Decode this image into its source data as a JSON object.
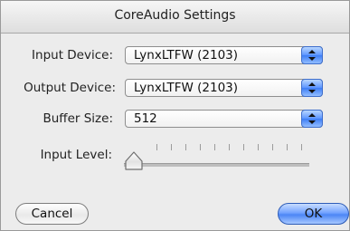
{
  "window": {
    "title": "CoreAudio Settings"
  },
  "input_device": {
    "label": "Input Device:",
    "value": "LynxLTFW (2103)"
  },
  "output_device": {
    "label": "Output Device:",
    "value": "LynxLTFW (2103)"
  },
  "buffer_size": {
    "label": "Buffer Size:",
    "value": "512"
  },
  "input_level": {
    "label": "Input Level:",
    "level": 0
  },
  "buttons": {
    "cancel_label": "Cancel",
    "ok_label": "OK"
  },
  "colors": {
    "accent_blue": "#4c86f5",
    "window_bg": "#ececec"
  }
}
